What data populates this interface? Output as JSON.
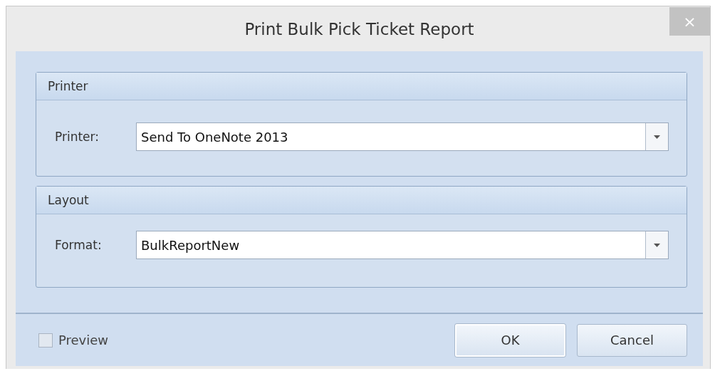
{
  "window": {
    "title": "Print Bulk Pick Ticket Report",
    "close": "×"
  },
  "groups": [
    {
      "title": "Printer",
      "label": "Printer:",
      "value": "Send To OneNote 2013"
    },
    {
      "title": "Layout",
      "label": "Format:",
      "value": "BulkReportNew"
    }
  ],
  "preview": {
    "label": "Preview",
    "checked": false
  },
  "buttons": [
    {
      "label": "OK",
      "kind": "default"
    },
    {
      "label": "Cancel",
      "kind": "normal"
    }
  ]
}
